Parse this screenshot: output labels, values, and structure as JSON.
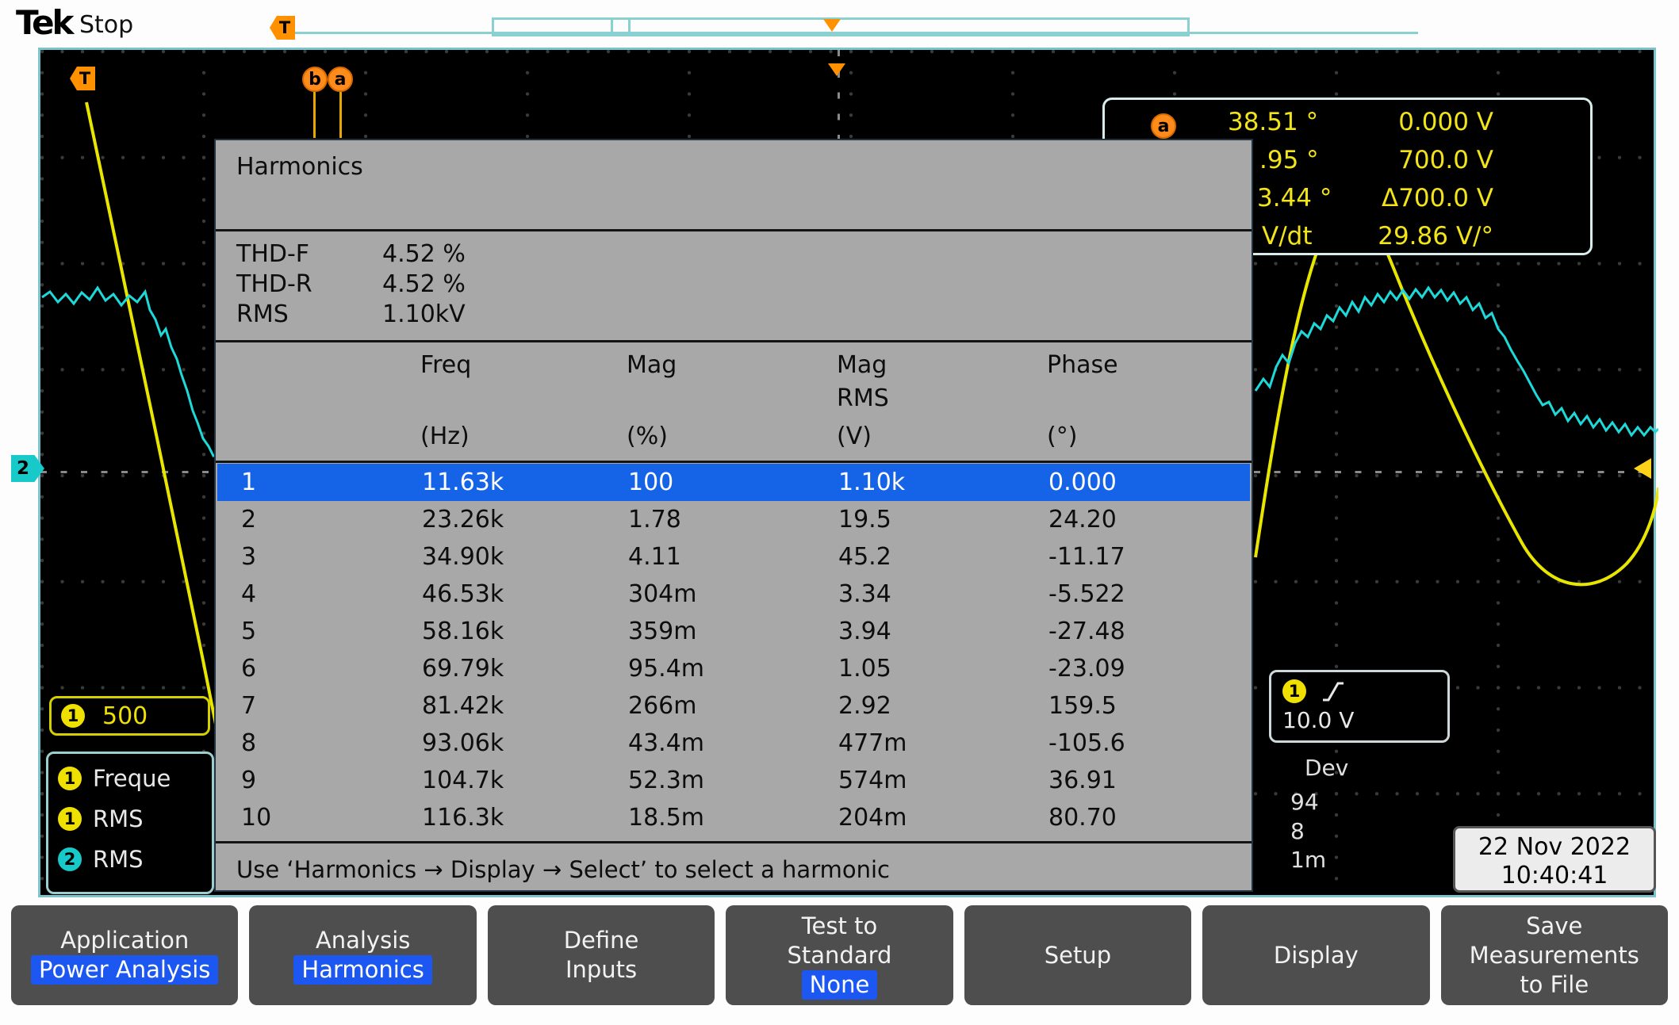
{
  "colors": {
    "highlight_blue": "#1b57f0",
    "selected_row_blue": "#1563e6",
    "ch1_yellow": "#e8e600",
    "ch2_cyan": "#1ed9d9",
    "marker_orange": "#ff8c1a",
    "panel_gray": "#a8a8a8"
  },
  "header": {
    "brand": "Tek",
    "status": "Stop"
  },
  "markers": {
    "trigger_tag": "T",
    "display_tag": "T",
    "cursor_b": "b",
    "cursor_a": "a"
  },
  "channels": {
    "ch2_badge": "2"
  },
  "cursor_readout": {
    "badge": "a",
    "rows": [
      {
        "left": "38.51 °",
        "right": "0.000 V"
      },
      {
        "left": ".95 °",
        "right": "700.0 V"
      },
      {
        "left": "3.44 °",
        "right": "Δ700.0 V"
      },
      {
        "left": "V/dt",
        "right": "29.86 V/°"
      }
    ]
  },
  "harmonics": {
    "title": "Harmonics",
    "summary": [
      {
        "label": "THD-F",
        "value": "4.52 %"
      },
      {
        "label": "THD-R",
        "value": "4.52 %"
      },
      {
        "label": "RMS",
        "value": "1.10kV"
      }
    ],
    "headers": {
      "freq": "Freq",
      "mag": "Mag",
      "magrms1": "Mag",
      "magrms2": "RMS",
      "phase": "Phase"
    },
    "units": {
      "freq": "(Hz)",
      "mag": "(%)",
      "magrms": "(V)",
      "phase": "(°)"
    },
    "rows": [
      [
        "1",
        "11.63k",
        "100",
        "1.10k",
        "0.000"
      ],
      [
        "2",
        "23.26k",
        "1.78",
        "19.5",
        "24.20"
      ],
      [
        "3",
        "34.90k",
        "4.11",
        "45.2",
        "-11.17"
      ],
      [
        "4",
        "46.53k",
        "304m",
        "3.34",
        "-5.522"
      ],
      [
        "5",
        "58.16k",
        "359m",
        "3.94",
        "-27.48"
      ],
      [
        "6",
        "69.79k",
        "95.4m",
        "1.05",
        "-23.09"
      ],
      [
        "7",
        "81.42k",
        "266m",
        "2.92",
        "159.5"
      ],
      [
        "8",
        "93.06k",
        "43.4m",
        "477m",
        "-105.6"
      ],
      [
        "9",
        "104.7k",
        "52.3m",
        "574m",
        "36.91"
      ],
      [
        "10",
        "116.3k",
        "18.5m",
        "204m",
        "80.70"
      ]
    ],
    "footer": "Use ‘Harmonics → Display → Select’ to select a harmonic"
  },
  "ch1_scale": {
    "badge": "1",
    "value": "500"
  },
  "measurements": {
    "items": [
      {
        "badge": "1",
        "label": "Freque"
      },
      {
        "badge": "1",
        "label": "RMS"
      },
      {
        "badge": "2",
        "label": "RMS"
      }
    ]
  },
  "trigger_info": {
    "badge": "1",
    "level": "10.0 V"
  },
  "fragments": {
    "f1": "Dev",
    "f2": "94",
    "f3": "8",
    "f4": "1m"
  },
  "datetime": {
    "date": "22 Nov 2022",
    "time": "10:40:41"
  },
  "menu": [
    {
      "line1": "Application",
      "highlight": "Power Analysis"
    },
    {
      "line1": "Analysis",
      "highlight": "Harmonics"
    },
    {
      "line1": "Define",
      "line2": "Inputs"
    },
    {
      "line1": "Test to",
      "line2": "Standard",
      "highlight": "None"
    },
    {
      "line1": "Setup"
    },
    {
      "line1": "Display"
    },
    {
      "line1": "Save",
      "line2": "Measurements",
      "line3": "to File"
    }
  ]
}
